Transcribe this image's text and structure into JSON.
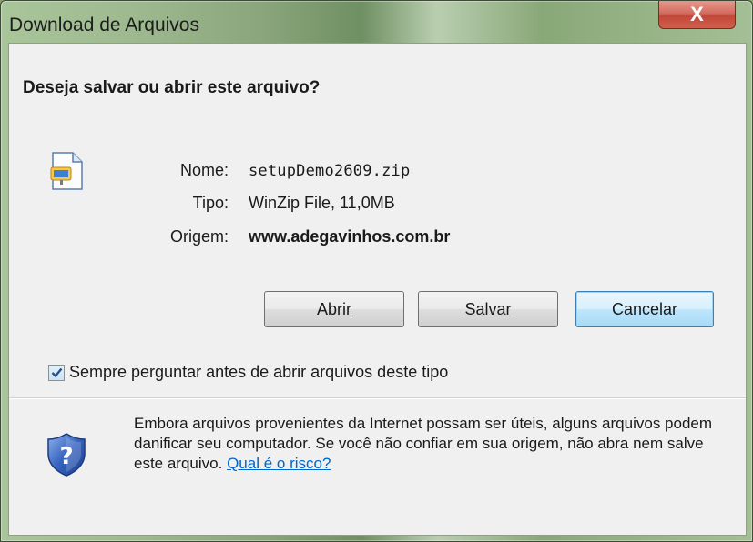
{
  "window": {
    "title": "Download de Arquivos",
    "close_label": "X"
  },
  "dialog": {
    "question": "Deseja salvar ou abrir este arquivo?",
    "file": {
      "name_label": "Nome:",
      "name_value": "setupDemo2609.zip",
      "type_label": "Tipo:",
      "type_value": "WinZip File, 11,0MB",
      "origin_label": "Origem:",
      "origin_value": "www.adegavinhos.com.br",
      "icon": "winzip-file-icon"
    },
    "buttons": {
      "open_label": "Abrir",
      "save_label": "Salvar",
      "cancel_label": "Cancelar"
    },
    "checkbox": {
      "checked": true,
      "label": "Sempre perguntar antes de abrir arquivos deste tipo"
    },
    "warning": {
      "icon": "shield-question-icon",
      "text": "Embora arquivos provenientes da Internet possam ser úteis, alguns arquivos podem danificar seu computador. Se você não confiar em sua origem, não abra nem salve este arquivo.",
      "link_text": "Qual é o risco?"
    }
  },
  "colors": {
    "link": "#0066cc",
    "close_button": "#c94a3c",
    "dialog_background": "#f0f0f0",
    "default_button_border": "#3c7fb1"
  }
}
